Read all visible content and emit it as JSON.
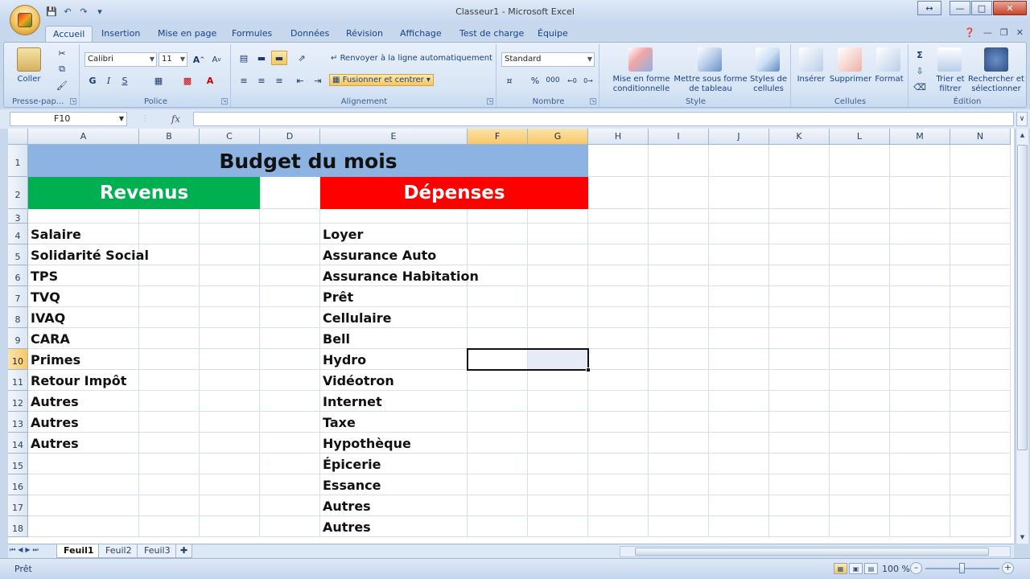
{
  "window": {
    "title": "Classeur1 - Microsoft Excel"
  },
  "tabs": [
    "Accueil",
    "Insertion",
    "Mise en page",
    "Formules",
    "Données",
    "Révision",
    "Affichage",
    "Test de charge",
    "Équipe"
  ],
  "ribbon": {
    "clipboard": {
      "paste_label": "Coller",
      "group_label": "Presse-pap..."
    },
    "font": {
      "font_name": "Calibri",
      "font_size": "11",
      "bold": "G",
      "italic": "I",
      "underline": "S",
      "group_label": "Police"
    },
    "alignment": {
      "wrap_label": "Renvoyer à la ligne automatiquement",
      "merge_label": "Fusionner et centrer",
      "group_label": "Alignement"
    },
    "number": {
      "format": "Standard",
      "percent": "%",
      "thousands": "000",
      "group_label": "Nombre"
    },
    "style": {
      "cond_format_label": "Mise en forme conditionnelle",
      "table_format_label": "Mettre sous forme de tableau",
      "cell_styles_label": "Styles de cellules",
      "group_label": "Style"
    },
    "cells": {
      "insert_label": "Insérer",
      "delete_label": "Supprimer",
      "format_label": "Format",
      "group_label": "Cellules"
    },
    "editing": {
      "sort_label": "Trier et filtrer",
      "find_label": "Rechercher et sélectionner",
      "group_label": "Édition"
    }
  },
  "formula_bar": {
    "name_box": "F10",
    "fx": "fx",
    "formula": ""
  },
  "sheet": {
    "columns": [
      "A",
      "B",
      "C",
      "D",
      "E",
      "F",
      "G",
      "H",
      "I",
      "J",
      "K",
      "L",
      "M",
      "N"
    ],
    "rows": [
      "1",
      "2",
      "3",
      "4",
      "5",
      "6",
      "7",
      "8",
      "9",
      "10",
      "11",
      "12",
      "13",
      "14",
      "15",
      "16",
      "17",
      "18"
    ],
    "title": "Budget du mois",
    "revenus_header": "Revenus",
    "depenses_header": "Dépenses",
    "revenus_items": [
      "Salaire",
      "Solidarité Social",
      "TPS",
      "TVQ",
      "IVAQ",
      "CARA",
      "Primes",
      "Retour Impôt",
      "Autres",
      "Autres",
      "Autres"
    ],
    "depenses_items": [
      "Loyer",
      "Assurance Auto",
      "Assurance Habitation",
      "Prêt",
      "Cellulaire",
      "Bell",
      "Hydro",
      "Vidéotron",
      "Internet",
      "Taxe",
      "Hypothèque",
      "Épicerie",
      "Essance",
      "Autres",
      "Autres"
    ],
    "selected_cell": "F10"
  },
  "sheet_tabs": [
    "Feuil1",
    "Feuil2",
    "Feuil3"
  ],
  "status": {
    "text": "Prêt",
    "zoom": "100 %"
  },
  "colors": {
    "title_bg": "#8db3e2",
    "revenus_bg": "#00b050",
    "depenses_bg": "#ff0000"
  }
}
